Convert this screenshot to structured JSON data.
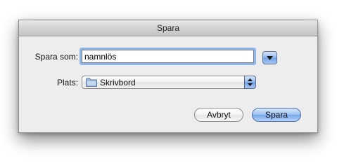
{
  "window": {
    "title": "Spara"
  },
  "form": {
    "name_label": "Spara som:",
    "name_value": "namnlös",
    "place_label": "Plats:",
    "place_value": "Skrivbord",
    "place_icon": "folder-icon",
    "expand_icon": "disclosure-triangle-icon"
  },
  "buttons": {
    "cancel_label": "Avbryt",
    "save_label": "Spara"
  },
  "colors": {
    "accent_blue": "#8fb4ea",
    "focus_ring": "#8fb6e8"
  }
}
